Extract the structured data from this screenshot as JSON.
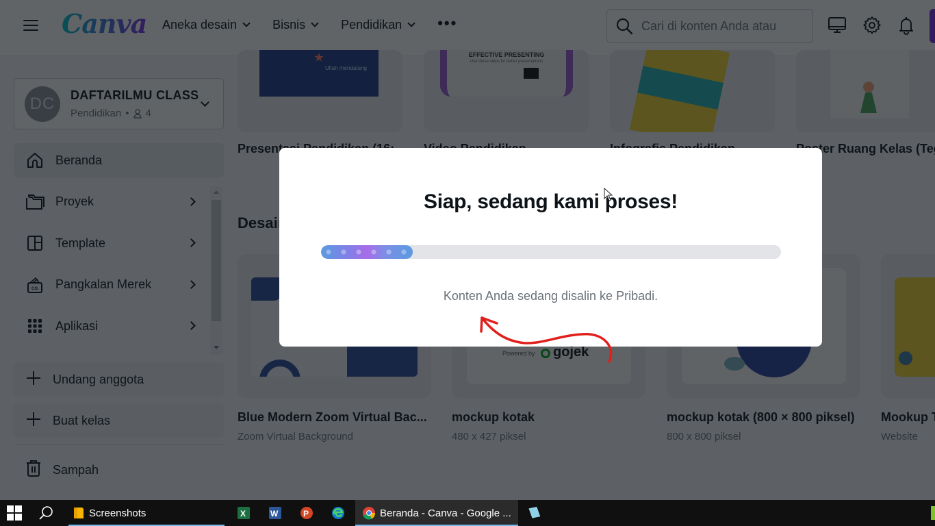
{
  "header": {
    "menu_icon": "hamburger-icon",
    "logo": "Canva",
    "nav": [
      {
        "label": "Aneka desain"
      },
      {
        "label": "Bisnis"
      },
      {
        "label": "Pendidikan"
      }
    ],
    "more_label": "•••",
    "search_placeholder": "Cari di konten Anda atau",
    "icons": [
      "desktop-icon",
      "gear-icon",
      "bell-icon"
    ]
  },
  "sidebar": {
    "team": {
      "initials": "DC",
      "name": "DAFTARILMU CLASS",
      "category": "Pendidikan",
      "separator": "•",
      "member_count": "4"
    },
    "items": [
      {
        "label": "Beranda",
        "icon": "home-icon",
        "active": true
      },
      {
        "label": "Proyek",
        "icon": "folder-icon"
      },
      {
        "label": "Template",
        "icon": "template-icon"
      },
      {
        "label": "Pangkalan Merek",
        "icon": "brand-kit-icon"
      },
      {
        "label": "Aplikasi",
        "icon": "apps-grid-icon"
      }
    ],
    "actions": [
      {
        "label": "Undang anggota",
        "icon": "plus-icon"
      },
      {
        "label": "Buat kelas",
        "icon": "plus-icon"
      }
    ],
    "trash": {
      "label": "Sampah",
      "icon": "trash-icon"
    }
  },
  "main": {
    "top_row": [
      {
        "title": "Presentasi Pendidikan (16:"
      },
      {
        "title": "Video Pendidikan"
      },
      {
        "title": "Infografis Pendidikan"
      },
      {
        "title": "Poster Ruang Kelas (Tegak)"
      }
    ],
    "section_title": "Desain terbaru",
    "designs": [
      {
        "title": "Blue Modern Zoom Virtual Bac...",
        "subtitle": "Zoom Virtual Background"
      },
      {
        "title": "mockup kotak",
        "subtitle": "480 x 427 piksel"
      },
      {
        "title": "mockup kotak (800 × 800 piksel)",
        "subtitle": "800 x 800 piksel"
      },
      {
        "title": "Mookup T",
        "subtitle": "Website"
      }
    ],
    "thumb_texts": {
      "effective": "EFFECTIVE PRESENTING",
      "effective_sub": "Use these steps for better presentations",
      "ultah": "Ultah mendatang",
      "gojek": "gojek",
      "powered_by": "Powered by"
    }
  },
  "modal": {
    "title": "Siap, sedang kami proses!",
    "progress_percent": 20,
    "message": "Konten Anda sedang disalin ke Pribadi."
  },
  "taskbar": {
    "items": [
      {
        "label": "Screenshots",
        "icon": "file-explorer-icon"
      },
      {
        "label": "",
        "icon": "excel-icon"
      },
      {
        "label": "",
        "icon": "word-icon"
      },
      {
        "label": "",
        "icon": "powerpoint-icon"
      },
      {
        "label": "",
        "icon": "edge-icon"
      },
      {
        "label": "Beranda - Canva - Google ...",
        "icon": "chrome-icon"
      },
      {
        "label": "",
        "icon": "notepad-icon"
      }
    ]
  },
  "colors": {
    "brand_purple": "#7d2ae8",
    "brand_teal": "#00c4cc",
    "annotation_red": "#e0201c"
  }
}
